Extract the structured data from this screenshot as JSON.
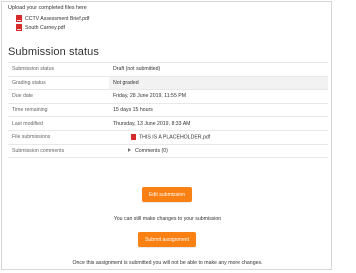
{
  "upload": {
    "label": "Upload your completed files here",
    "files": [
      "CCTV Assessment Brief.pdf",
      "South Carney.pdf"
    ]
  },
  "section_title": "Submission status",
  "status_rows": [
    {
      "label": "Submission status",
      "value": "Draft (not submitted)"
    },
    {
      "label": "Grading status",
      "value": "Not graded"
    },
    {
      "label": "Due date",
      "value": "Friday, 28 June 2019, 11:55 PM"
    },
    {
      "label": "Time remaining",
      "value": "15 days 15 hours"
    },
    {
      "label": "Last modified",
      "value": "Thursday, 13 June 2019, 8:33 AM"
    },
    {
      "label": "File submissions",
      "value": "THIS IS A PLACEHOLDER.pdf"
    },
    {
      "label": "Submission comments",
      "value": "Comments (0)"
    }
  ],
  "buttons": {
    "edit_submission": "Edit submission",
    "submit_assignment": "Submit assignment"
  },
  "notes": {
    "can_still_change": "You can still make changes to your submission",
    "submit_warning": "Once this assignment is submitted you will not be able to make any more changes."
  },
  "colors": {
    "accent": "#f98012",
    "pdf_icon": "#d62b2b"
  }
}
